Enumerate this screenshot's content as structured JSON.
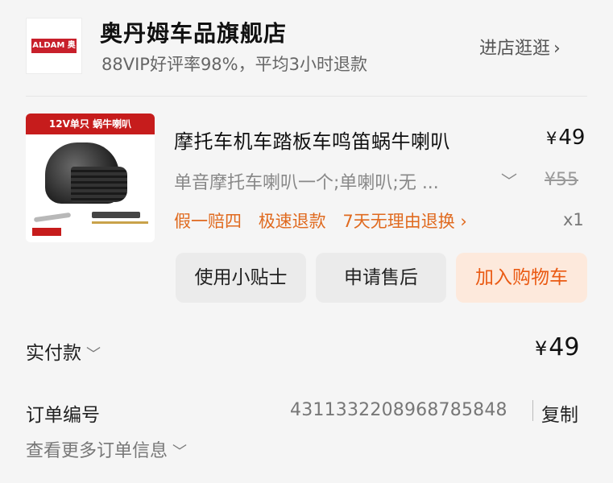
{
  "store": {
    "logo_text": "ALDAM 奥丹姆",
    "name": "奥丹姆车品旗舰店",
    "subtitle": "88VIP好评率98%，平均3小时退款",
    "visit_label": "进店逛逛",
    "visit_chevron": "›"
  },
  "product": {
    "image_banner": "12V单只  蜗牛喇叭",
    "title": "摩托车机车踏板车鸣笛蜗牛喇叭",
    "price_symbol": "¥",
    "price": "49",
    "sku": "单音摩托车喇叭一个;单喇叭;无 ...",
    "sku_chevron": "﹀",
    "original_price": "¥55",
    "tags": [
      "假一赔四",
      "极速退款",
      "7天无理由退换 ›"
    ],
    "quantity": "x1"
  },
  "actions": {
    "tips_label": "使用小贴士",
    "after_sale_label": "申请售后",
    "add_cart_label": "加入购物车"
  },
  "payment": {
    "label": "实付款",
    "label_chevron": "﹀",
    "amount_symbol": "¥",
    "amount": "49"
  },
  "order": {
    "number_label": "订单编号",
    "number": "4311332208968785848",
    "copy_label": "复制",
    "more_label": "查看更多订单信息",
    "more_chevron": "﹀"
  },
  "colors": {
    "accent": "#ea5a13",
    "cart_bg": "#fde9dc",
    "brand_red": "#c61c1c"
  }
}
